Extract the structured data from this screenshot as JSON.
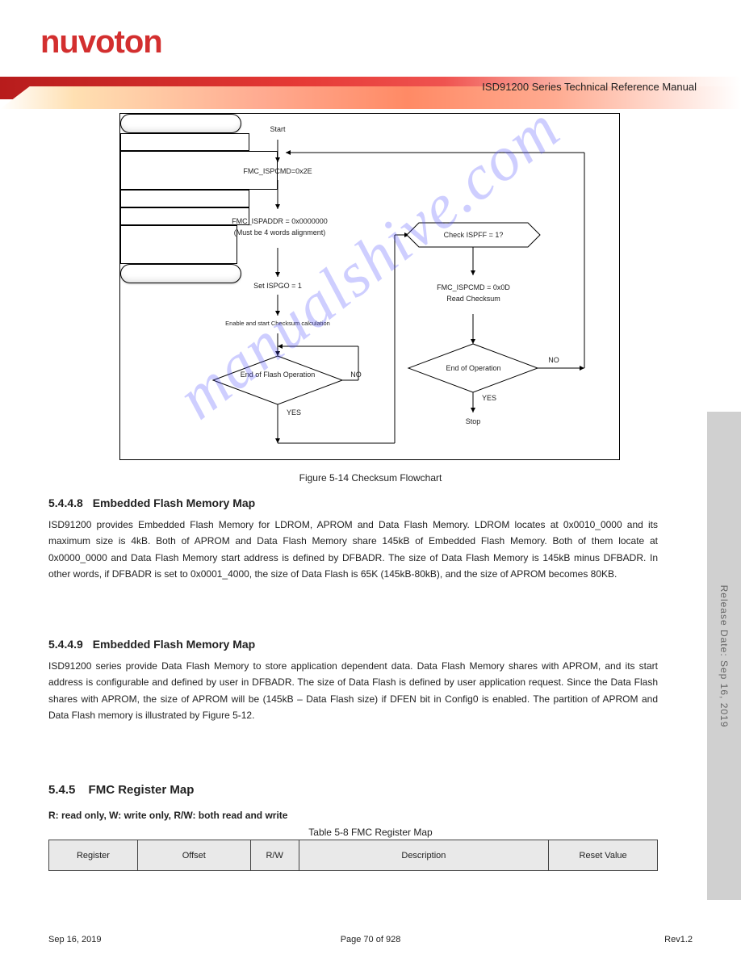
{
  "header": {
    "logo": "nuvoTon",
    "doc_ref": "ISD91200 Series Technical Reference Manual"
  },
  "flowchart": {
    "start": "Start",
    "a1": "FMC_ISPCMD=0x2E",
    "a2_l1": "FMC_ISPADDR = 0x0000000",
    "a2_l2": "(Must be 4 words alignment)",
    "a3": "Set ISPGO = 1",
    "a4": "Enable and start Checksum calculation",
    "d1": "End of Flash Operation",
    "d1_no": "NO",
    "d1_yes": "YES",
    "b1": "Check ISPFF = 1?",
    "b2_l1": "FMC_ISPCMD = 0x0D",
    "b2_l2": "Read Checksum",
    "d2": "End of Operation",
    "d2_no": "NO",
    "d2_yes": "YES",
    "end": "Stop"
  },
  "captions": {
    "fig": "Figure 5-14 Checksum Flowchart",
    "tbl": "Table 5-8 FMC Register Map"
  },
  "sections": {
    "s1_num": "5.4.4.8",
    "s1_title": "Embedded Flash Memory Map",
    "s1_body": "ISD91200 provides Embedded Flash Memory for LDROM, APROM and Data Flash Memory. LDROM locates at 0x0010_0000 and its maximum size is 4kB. Both of APROM and Data Flash Memory share 145kB of Embedded Flash Memory. Both of them locate at 0x0000_0000 and Data Flash Memory start address is defined by DFBADR. The size of Data Flash Memory is 145kB minus DFBADR. In other words, if DFBADR is set to 0x0001_4000, the size of Data Flash is 65K (145kB-80kB), and the size of APROM becomes 80KB.",
    "s2_num": "5.4.4.9",
    "s2_title": "Embedded Flash Memory Map",
    "s2_body": "ISD91200 series provide Data Flash Memory to store application dependent data. Data Flash Memory shares with APROM, and its start address is configurable and defined by user in DFBADR. The size of Data Flash is defined by user application request. Since the Data Flash shares with APROM, the size of APROM will be (145kB – Data Flash size) if DFEN bit in Config0 is enabled. The partition of APROM and Data Flash memory is illustrated by Figure 5-12.",
    "s3_num": "5.4.5",
    "s3_title": "FMC Register Map",
    "s3_lead": "R: read only, W: write only, R/W: both read and write"
  },
  "table": {
    "h1": "Register",
    "h2": "Offset",
    "h3": "R/W",
    "h4": "Description",
    "h5": "Reset Value"
  },
  "side_label": "Release Date: Sep 16, 2019",
  "footer": {
    "date": "Sep 16, 2019",
    "page": "Page 70 of 928",
    "rev": "Rev1.2"
  },
  "watermark": "manualshive.com"
}
